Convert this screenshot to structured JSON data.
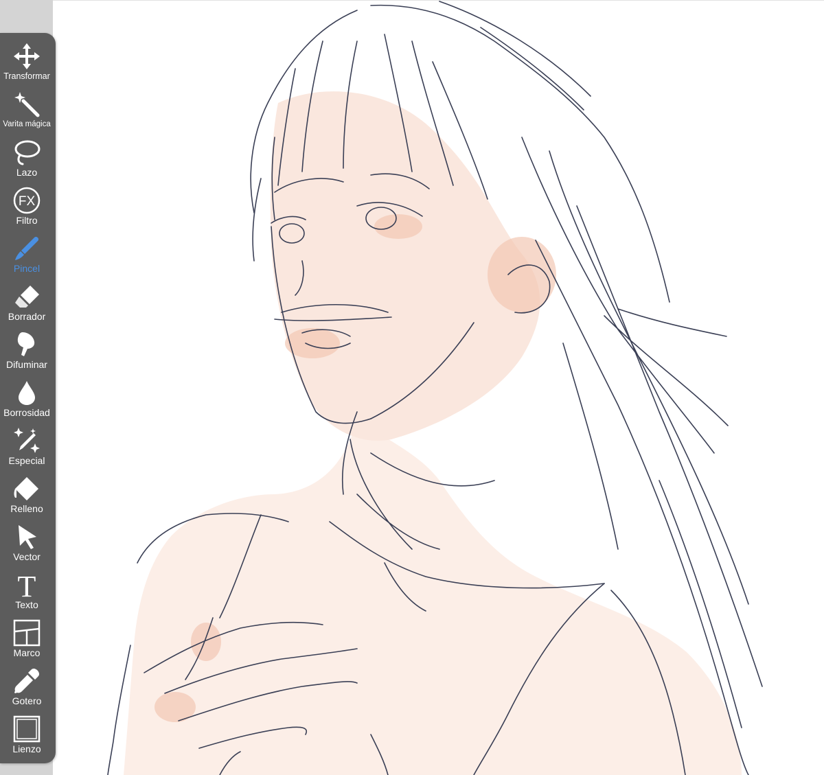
{
  "toolbar": {
    "accent_color": "#4a90e2",
    "items": [
      {
        "label": "Transformar",
        "icon": "move-arrows-icon"
      },
      {
        "label": "Varita mágica",
        "icon": "magic-wand-icon"
      },
      {
        "label": "Lazo",
        "icon": "lasso-icon"
      },
      {
        "label": "Filtro",
        "icon": "fx-filter-icon"
      },
      {
        "label": "Pincel",
        "icon": "brush-icon",
        "active": true
      },
      {
        "label": "Borrador",
        "icon": "eraser-icon"
      },
      {
        "label": "Difuminar",
        "icon": "smudge-finger-icon"
      },
      {
        "label": "Borrosidad",
        "icon": "blur-drop-icon"
      },
      {
        "label": "Especial",
        "icon": "special-pen-sparkle-icon"
      },
      {
        "label": "Relleno",
        "icon": "fill-bucket-icon"
      },
      {
        "label": "Vector",
        "icon": "vector-cursor-icon"
      },
      {
        "label": "Texto",
        "icon": "text-t-icon"
      },
      {
        "label": "Marco",
        "icon": "frame-divider-icon"
      },
      {
        "label": "Gotero",
        "icon": "eyedropper-icon"
      },
      {
        "label": "Lienzo",
        "icon": "canvas-square-icon"
      }
    ]
  },
  "canvas": {
    "background": "#ffffff",
    "line_color": "#3a3f55",
    "skin_color": "#f9e3d8"
  }
}
